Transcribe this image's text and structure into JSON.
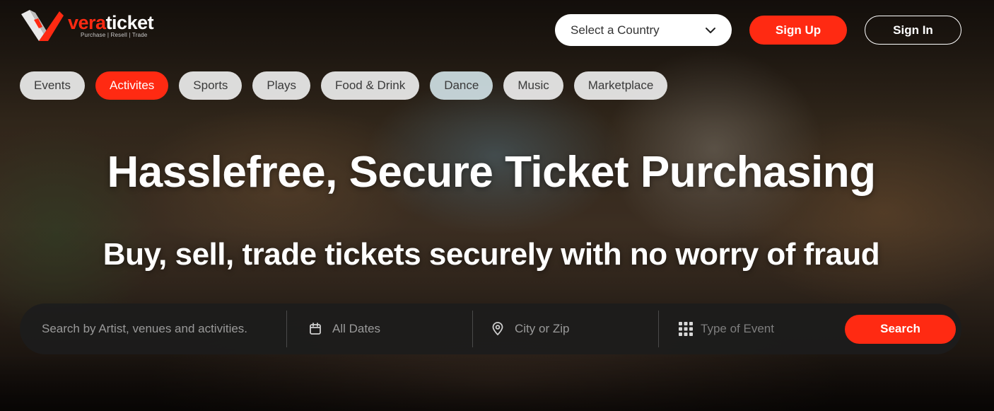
{
  "brand": {
    "name_part1": "vera",
    "name_part2": "ticket",
    "tagline": "Purchase | Resell | Trade",
    "accent_color": "#ff2a12"
  },
  "header": {
    "country_select": {
      "value": "Select a Country",
      "icon": "chevron-down-icon"
    },
    "signup_label": "Sign Up",
    "signin_label": "Sign In"
  },
  "categories": [
    {
      "label": "Events",
      "active": false
    },
    {
      "label": "Activites",
      "active": true
    },
    {
      "label": "Sports",
      "active": false
    },
    {
      "label": "Plays",
      "active": false
    },
    {
      "label": "Food & Drink",
      "active": false
    },
    {
      "label": "Dance",
      "active": false
    },
    {
      "label": "Music",
      "active": false
    },
    {
      "label": "Marketplace",
      "active": false
    }
  ],
  "hero": {
    "headline": "Hasslefree, Secure Ticket Purchasing",
    "subheadline": "Buy, sell, trade tickets securely with no worry of fraud"
  },
  "search": {
    "query_placeholder": "Search by Artist, venues and activities.",
    "dates_label": "All Dates",
    "dates_icon": "calendar-icon",
    "location_placeholder": "City or Zip",
    "location_icon": "location-pin-icon",
    "type_placeholder": "Type of Event",
    "type_icon": "grid-icon",
    "button_label": "Search"
  }
}
